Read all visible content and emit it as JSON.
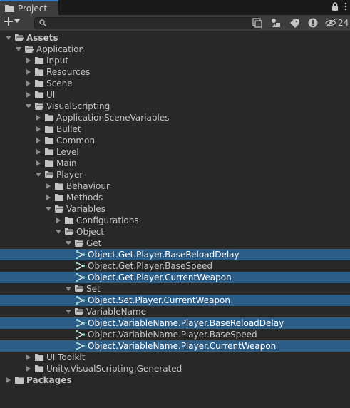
{
  "tab": {
    "title": "Project"
  },
  "toolbar": {
    "search_value": "",
    "hidden_count": "24"
  },
  "tree": [
    {
      "label": "Assets",
      "depth": 0,
      "type": "folder-open",
      "bold": true
    },
    {
      "label": "Application",
      "depth": 1,
      "type": "folder-open"
    },
    {
      "label": "Input",
      "depth": 2,
      "type": "folder-closed"
    },
    {
      "label": "Resources",
      "depth": 2,
      "type": "folder-closed"
    },
    {
      "label": "Scene",
      "depth": 2,
      "type": "folder-closed"
    },
    {
      "label": "UI",
      "depth": 2,
      "type": "folder-closed"
    },
    {
      "label": "VisualScripting",
      "depth": 2,
      "type": "folder-open"
    },
    {
      "label": "ApplicationSceneVariables",
      "depth": 3,
      "type": "folder-closed"
    },
    {
      "label": "Bullet",
      "depth": 3,
      "type": "folder-closed"
    },
    {
      "label": "Common",
      "depth": 3,
      "type": "folder-closed"
    },
    {
      "label": "Level",
      "depth": 3,
      "type": "folder-closed"
    },
    {
      "label": "Main",
      "depth": 3,
      "type": "folder-closed"
    },
    {
      "label": "Player",
      "depth": 3,
      "type": "folder-open"
    },
    {
      "label": "Behaviour",
      "depth": 4,
      "type": "folder-closed"
    },
    {
      "label": "Methods",
      "depth": 4,
      "type": "folder-closed"
    },
    {
      "label": "Variables",
      "depth": 4,
      "type": "folder-open"
    },
    {
      "label": "Configurations",
      "depth": 5,
      "type": "folder-closed"
    },
    {
      "label": "Object",
      "depth": 5,
      "type": "folder-open"
    },
    {
      "label": "Get",
      "depth": 6,
      "type": "folder-open"
    },
    {
      "label": "Object.Get.Player.BaseReloadDelay",
      "depth": 7,
      "type": "asset",
      "selected": true
    },
    {
      "label": "Object.Get.Player.BaseSpeed",
      "depth": 7,
      "type": "asset"
    },
    {
      "label": "Object.Get.Player.CurrentWeapon",
      "depth": 7,
      "type": "asset",
      "selected": true
    },
    {
      "label": "Set",
      "depth": 6,
      "type": "folder-open"
    },
    {
      "label": "Object.Set.Player.CurrentWeapon",
      "depth": 7,
      "type": "asset",
      "selected": true
    },
    {
      "label": "VariableName",
      "depth": 6,
      "type": "folder-open"
    },
    {
      "label": "Object.VariableName.Player.BaseReloadDelay",
      "depth": 7,
      "type": "asset",
      "selected": true
    },
    {
      "label": "Object.VariableName.Player.BaseSpeed",
      "depth": 7,
      "type": "asset"
    },
    {
      "label": "Object.VariableName.Player.CurrentWeapon",
      "depth": 7,
      "type": "asset",
      "selected": true
    },
    {
      "label": "UI Toolkit",
      "depth": 2,
      "type": "folder-closed"
    },
    {
      "label": "Unity.VisualScripting.Generated",
      "depth": 2,
      "type": "folder-closed"
    },
    {
      "label": "Packages",
      "depth": 0,
      "type": "folder-closed",
      "bold": true
    }
  ]
}
